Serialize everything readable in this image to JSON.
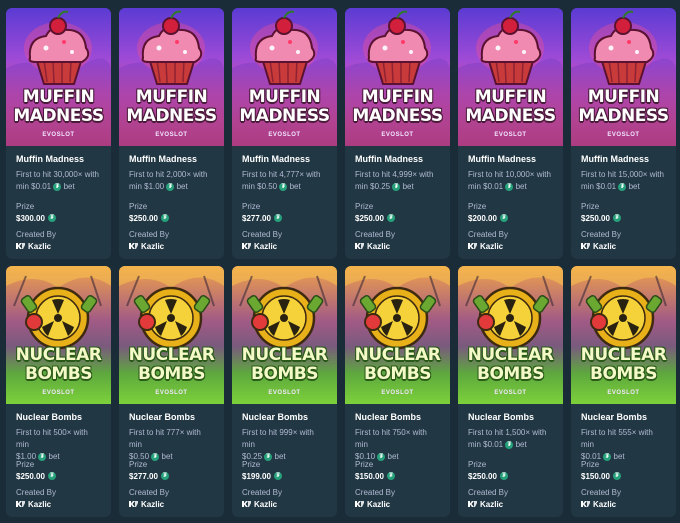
{
  "labels": {
    "prize": "Prize",
    "created_by": "Created By"
  },
  "icons": {
    "currency": "tether-coin-icon",
    "creator": "kazlic-logo-icon"
  },
  "colors": {
    "background": "#1a2c38",
    "card": "#213743",
    "muted_text": "#b1bad3",
    "coin": "#26a17b"
  },
  "cards": [
    {
      "theme": "muffin",
      "art_title_1": "MUFFIN",
      "art_title_2": "MADNESS",
      "art_studio": "EVOSLOT",
      "name": "Muffin Madness",
      "desc_1": "First to hit 30,000× with",
      "desc_2": "min $0.01",
      "desc_3": "bet",
      "prize": "$300.00",
      "creator": "Kazlic"
    },
    {
      "theme": "muffin",
      "art_title_1": "MUFFIN",
      "art_title_2": "MADNESS",
      "art_studio": "EVOSLOT",
      "name": "Muffin Madness",
      "desc_1": "First to hit 2,000× with",
      "desc_2": "min $1.00",
      "desc_3": "bet",
      "prize": "$250.00",
      "creator": "Kazlic"
    },
    {
      "theme": "muffin",
      "art_title_1": "MUFFIN",
      "art_title_2": "MADNESS",
      "art_studio": "EVOSLOT",
      "name": "Muffin Madness",
      "desc_1": "First to hit 4,777× with",
      "desc_2": "min $0.50",
      "desc_3": "bet",
      "prize": "$277.00",
      "creator": "Kazlic"
    },
    {
      "theme": "muffin",
      "art_title_1": "MUFFIN",
      "art_title_2": "MADNESS",
      "art_studio": "EVOSLOT",
      "name": "Muffin Madness",
      "desc_1": "First to hit 4,999× with",
      "desc_2": "min $0.25",
      "desc_3": "bet",
      "prize": "$250.00",
      "creator": "Kazlic"
    },
    {
      "theme": "muffin",
      "art_title_1": "MUFFIN",
      "art_title_2": "MADNESS",
      "art_studio": "EVOSLOT",
      "name": "Muffin Madness",
      "desc_1": "First to hit 10,000× with",
      "desc_2": "min $0.01",
      "desc_3": "bet",
      "prize": "$200.00",
      "creator": "Kazlic"
    },
    {
      "theme": "muffin",
      "art_title_1": "MUFFIN",
      "art_title_2": "MADNESS",
      "art_studio": "EVOSLOT",
      "name": "Muffin Madness",
      "desc_1": "First to hit 15,000× with",
      "desc_2": "min $0.01",
      "desc_3": "bet",
      "prize": "$250.00",
      "creator": "Kazlic"
    },
    {
      "theme": "nuclear",
      "art_title_1": "NUCLEAR",
      "art_title_2": "BOMBS",
      "art_studio": "EVOSLOT",
      "name": "Nuclear Bombs",
      "desc_1": "First to hit 500× with min",
      "desc_2": "$1.00",
      "desc_3": "bet",
      "prize": "$250.00",
      "creator": "Kazlic"
    },
    {
      "theme": "nuclear",
      "art_title_1": "NUCLEAR",
      "art_title_2": "BOMBS",
      "art_studio": "EVOSLOT",
      "name": "Nuclear Bombs",
      "desc_1": "First to hit 777× with min",
      "desc_2": "$0.50",
      "desc_3": "bet",
      "prize": "$277.00",
      "creator": "Kazlic"
    },
    {
      "theme": "nuclear",
      "art_title_1": "NUCLEAR",
      "art_title_2": "BOMBS",
      "art_studio": "EVOSLOT",
      "name": "Nuclear Bombs",
      "desc_1": "First to hit 999× with min",
      "desc_2": "$0.25",
      "desc_3": "bet",
      "prize": "$199.00",
      "creator": "Kazlic"
    },
    {
      "theme": "nuclear",
      "art_title_1": "NUCLEAR",
      "art_title_2": "BOMBS",
      "art_studio": "EVOSLOT",
      "name": "Nuclear Bombs",
      "desc_1": "First to hit 750× with min",
      "desc_2": "$0.10",
      "desc_3": "bet",
      "prize": "$150.00",
      "creator": "Kazlic"
    },
    {
      "theme": "nuclear",
      "art_title_1": "NUCLEAR",
      "art_title_2": "BOMBS",
      "art_studio": "EVOSLOT",
      "name": "Nuclear Bombs",
      "desc_1": "First to hit 1,500× with",
      "desc_2": "min $0.01",
      "desc_3": "bet",
      "prize": "$250.00",
      "creator": "Kazlic"
    },
    {
      "theme": "nuclear",
      "art_title_1": "NUCLEAR",
      "art_title_2": "BOMBS",
      "art_studio": "EVOSLOT",
      "name": "Nuclear Bombs",
      "desc_1": "First to hit 555× with min",
      "desc_2": "$0.01",
      "desc_3": "bet",
      "prize": "$150.00",
      "creator": "Kazlic"
    }
  ]
}
